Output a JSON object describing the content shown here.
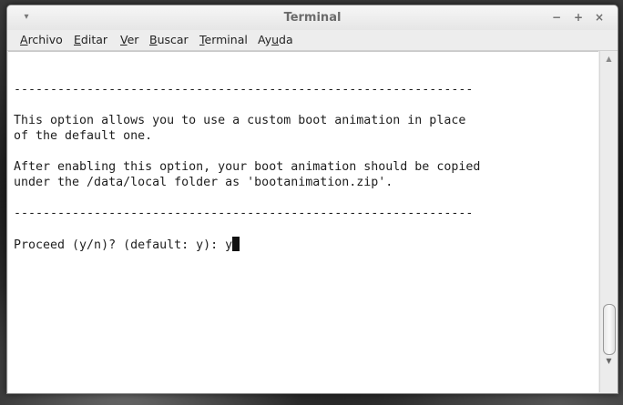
{
  "window": {
    "title": "Terminal"
  },
  "titlebar_buttons": {
    "menu_icon": "▾",
    "minimize": "−",
    "maximize": "+",
    "close": "×"
  },
  "menubar": {
    "items": [
      {
        "mnemonic": "A",
        "rest": "rchivo"
      },
      {
        "mnemonic": "E",
        "rest": "ditar"
      },
      {
        "mnemonic": "V",
        "rest": "er"
      },
      {
        "mnemonic": "B",
        "rest": "uscar"
      },
      {
        "mnemonic": "T",
        "rest": "erminal"
      },
      {
        "pre": "Ay",
        "mnemonic": "u",
        "rest": "da"
      }
    ]
  },
  "terminal": {
    "lines": [
      "",
      "---------------------------------------------------------------",
      "",
      "This option allows you to use a custom boot animation in place",
      "of the default one.",
      "",
      "After enabling this option, your boot animation should be copied",
      "under the /data/local folder as 'bootanimation.zip'.",
      "",
      "---------------------------------------------------------------",
      "",
      "Proceed (y/n)? (default: y): y"
    ]
  },
  "scrollbar": {
    "up_arrow": "▲",
    "down_arrow": "▼"
  }
}
